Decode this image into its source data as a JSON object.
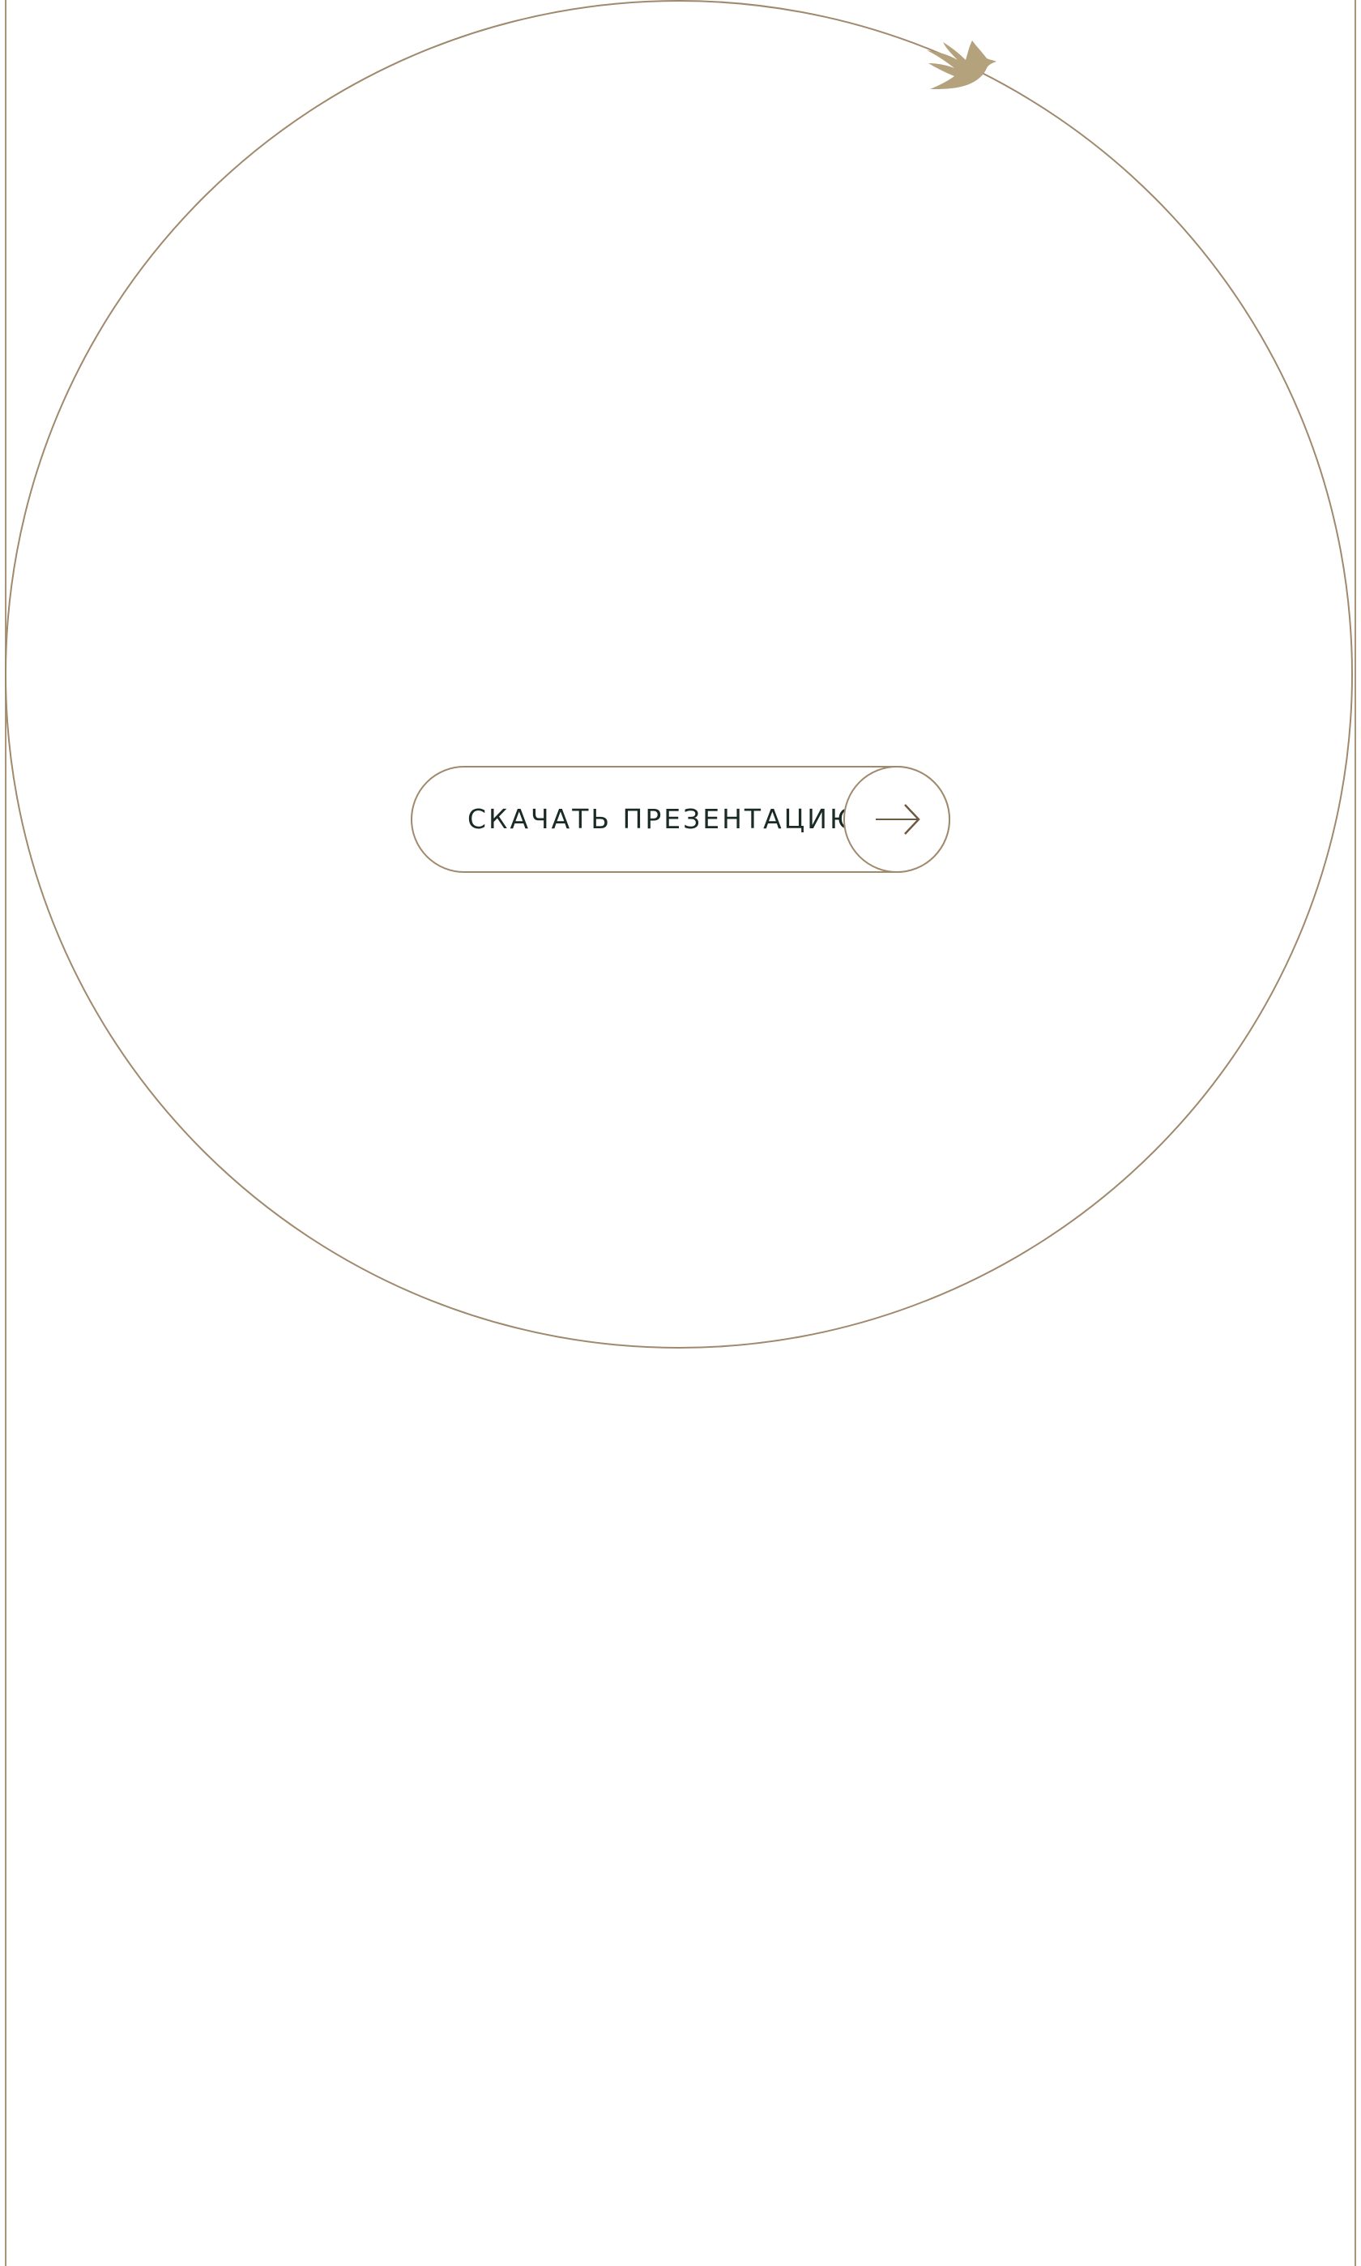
{
  "colors": {
    "accent": "#a08a6e",
    "bird": "#b3a27c",
    "text": "#1a2a25",
    "background": "#ffffff"
  },
  "icons": {
    "logo": "swallow-bird-icon",
    "cta_arrow": "arrow-right-icon"
  },
  "cta": {
    "label": "СКАЧАТЬ ПРЕЗЕНТАЦИЮ"
  }
}
